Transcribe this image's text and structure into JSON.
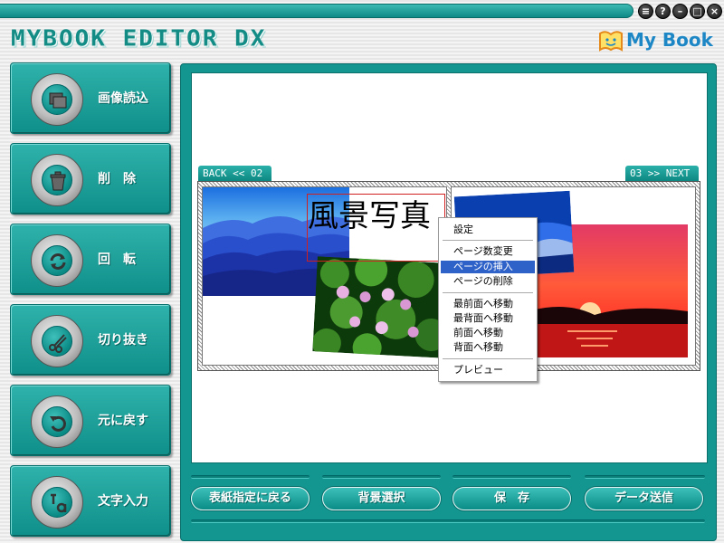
{
  "app": {
    "title": "MYBOOK EDITOR DX",
    "logo_text": "My Book"
  },
  "window_controls": [
    {
      "name": "menu",
      "glyph": "≡"
    },
    {
      "name": "help",
      "glyph": "?"
    },
    {
      "name": "minimize",
      "glyph": "–"
    },
    {
      "name": "maximize",
      "glyph": "□"
    },
    {
      "name": "close",
      "glyph": "×"
    }
  ],
  "sidebar": {
    "items": [
      {
        "label": "画像読込",
        "icon": "image-load-icon"
      },
      {
        "label": "削　除",
        "icon": "trash-icon"
      },
      {
        "label": "回　転",
        "icon": "rotate-icon"
      },
      {
        "label": "切り抜き",
        "icon": "scissors-icon"
      },
      {
        "label": "元に戻す",
        "icon": "undo-icon"
      },
      {
        "label": "文字入力",
        "icon": "text-input-icon"
      }
    ]
  },
  "nav": {
    "back": "BACK << 02",
    "next": "03 >> NEXT"
  },
  "page_text": "風景写真",
  "context_menu": {
    "items": [
      {
        "label": "設定",
        "highlighted": false
      },
      {
        "label": "ページ数変更",
        "highlighted": false
      },
      {
        "label": "ページの挿入",
        "highlighted": true
      },
      {
        "label": "ページの削除",
        "highlighted": false
      },
      {
        "label": "最前面へ移動",
        "highlighted": false
      },
      {
        "label": "最背面へ移動",
        "highlighted": false
      },
      {
        "label": "前面へ移動",
        "highlighted": false
      },
      {
        "label": "背面へ移動",
        "highlighted": false
      },
      {
        "label": "プレビュー",
        "highlighted": false
      }
    ]
  },
  "bottom_buttons": [
    {
      "label": "表紙指定に戻る"
    },
    {
      "label": "背景選択"
    },
    {
      "label": "保　存"
    },
    {
      "label": "データ送信"
    }
  ],
  "colors": {
    "teal": "#139590",
    "highlight": "#2f62c8",
    "selection": "#d02020"
  }
}
